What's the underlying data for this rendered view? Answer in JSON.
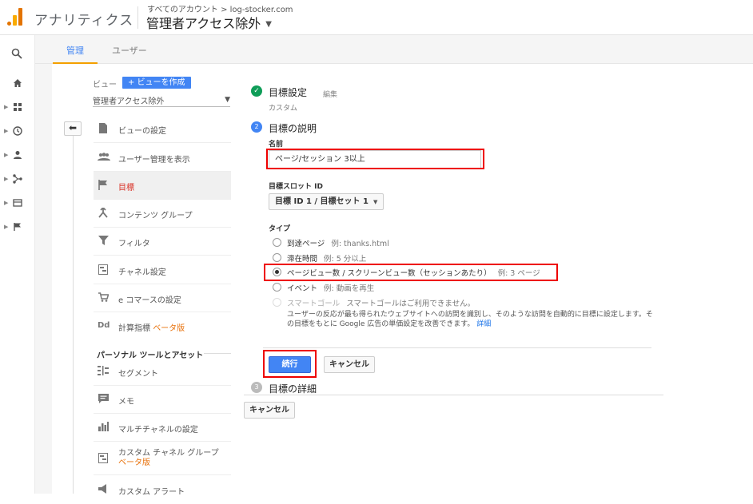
{
  "header": {
    "app_title": "アナリティクス",
    "breadcrumb": "すべてのアカウント > log-stocker.com",
    "view_name": "管理者アクセス除外"
  },
  "tabs": [
    {
      "label": "管理",
      "active": true
    },
    {
      "label": "ユーザー",
      "active": false
    }
  ],
  "left_rail": {
    "icons": [
      "search-icon",
      "home-icon",
      "customization-icon",
      "realtime-icon",
      "audience-icon",
      "acquisition-icon",
      "behavior-icon",
      "conversions-icon"
    ]
  },
  "view_column": {
    "label": "ビュー",
    "create_button": "+ ビューを作成",
    "selected_view": "管理者アクセス除外",
    "menu": [
      {
        "label": "ビューの設定",
        "icon": "document-icon",
        "active": false
      },
      {
        "label": "ユーザー管理を表示",
        "icon": "users-icon",
        "active": false
      },
      {
        "label": "目標",
        "icon": "flag-icon",
        "active": true
      },
      {
        "label": "コンテンツ グループ",
        "icon": "content-grouping-icon",
        "active": false
      },
      {
        "label": "フィルタ",
        "icon": "filter-icon",
        "active": false
      },
      {
        "label": "チャネル設定",
        "icon": "channel-icon",
        "active": false
      },
      {
        "label": "e コマースの設定",
        "icon": "cart-icon",
        "active": false
      },
      {
        "label": "計算指標",
        "beta": "ベータ版",
        "icon": "calculated-metrics-icon",
        "active": false
      }
    ],
    "section_header": "パーソナル ツールとアセット",
    "personal_menu": [
      {
        "label": "セグメント",
        "icon": "segment-icon"
      },
      {
        "label": "メモ",
        "icon": "annotation-icon"
      },
      {
        "label": "マルチチャネルの設定",
        "icon": "bar-chart-icon"
      },
      {
        "label": "カスタム チャネル グループ",
        "beta": "ベータ版",
        "icon": "channel-group-icon"
      },
      {
        "label": "カスタム アラート",
        "icon": "megaphone-icon"
      }
    ]
  },
  "goal_setup": {
    "step1": {
      "title": "目標設定",
      "edit": "編集",
      "subtitle": "カスタム"
    },
    "step2": {
      "number": "2",
      "title": "目標の説明",
      "name_label": "名前",
      "name_value": "ページ/セッション 3以上",
      "slot_label": "目標スロット ID",
      "slot_value": "目標 ID 1 / 目標セット 1",
      "type_label": "タイプ",
      "types": [
        {
          "label": "到達ページ",
          "example": "例: thanks.html",
          "selected": false,
          "disabled": false
        },
        {
          "label": "滞在時間",
          "example": "例: 5 分以上",
          "selected": false,
          "disabled": false
        },
        {
          "label": "ページビュー数 / スクリーンビュー数（セッションあたり）",
          "example": "例: 3 ページ",
          "selected": true,
          "disabled": false
        },
        {
          "label": "イベント",
          "example": "例: 動画を再生",
          "selected": false,
          "disabled": false
        },
        {
          "label": "スマートゴール",
          "example": "スマートゴールはご利用できません。",
          "selected": false,
          "disabled": true
        }
      ],
      "smart_goal_note": "ユーザーの反応が最も得られたウェブサイトへの訪問を識別し、そのような訪問を自動的に目標に設定します。その目標をもとに Google 広告の単価設定を改善できます。",
      "details_link": "詳細",
      "continue_button": "続行",
      "cancel_button": "キャンセル"
    },
    "step3": {
      "number": "3",
      "title": "目標の詳細"
    },
    "bottom_cancel": "キャンセル"
  }
}
